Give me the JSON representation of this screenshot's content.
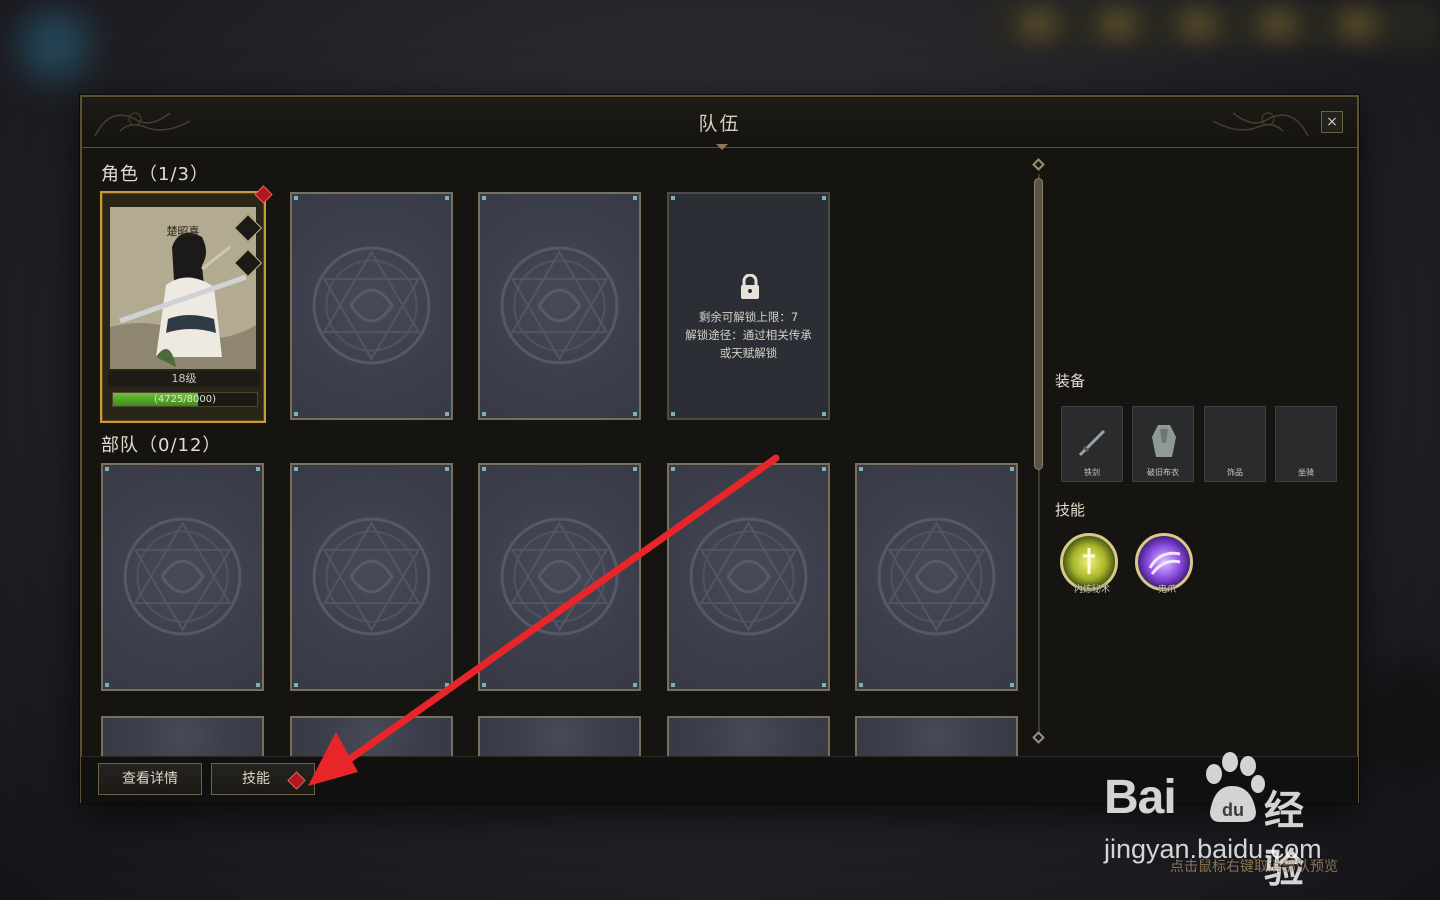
{
  "window": {
    "title": "队伍",
    "close_label": "×"
  },
  "roles": {
    "title": "角色（1/3）",
    "hero": {
      "name": "楚昭喜",
      "level": "18级",
      "exp_text": "(4725/8000)",
      "exp_fraction": 0.59
    },
    "locked_slot": {
      "line1": "剩余可解锁上限：7",
      "line2": "解锁途径：通过相关传承",
      "line3": "或天赋解锁"
    }
  },
  "troops": {
    "title": "部队（0/12）"
  },
  "equipment": {
    "title": "装备",
    "slots": [
      {
        "label": "铁剑",
        "icon": "sword-icon"
      },
      {
        "label": "破旧布衣",
        "icon": "cloth-armor-icon"
      },
      {
        "label": "饰品",
        "icon": ""
      },
      {
        "label": "坐骑",
        "icon": ""
      }
    ]
  },
  "skills": {
    "title": "技能",
    "items": [
      {
        "label": "内炼秘术",
        "color": "#b9c83a"
      },
      {
        "label": "鬼爪",
        "color": "#8a4be0"
      }
    ]
  },
  "footer": {
    "details_button": "查看详情",
    "skills_button": "技能"
  },
  "watermark": {
    "brand": "Bai",
    "brand_cn": "经验",
    "paw_text": "du",
    "url": "jingyan.baidu.com"
  },
  "hint": "点击鼠标右键取消部队预览",
  "colors": {
    "accent_gold": "#c79a3a",
    "alert_red": "#b01820",
    "arrow_red": "#e8262a"
  }
}
